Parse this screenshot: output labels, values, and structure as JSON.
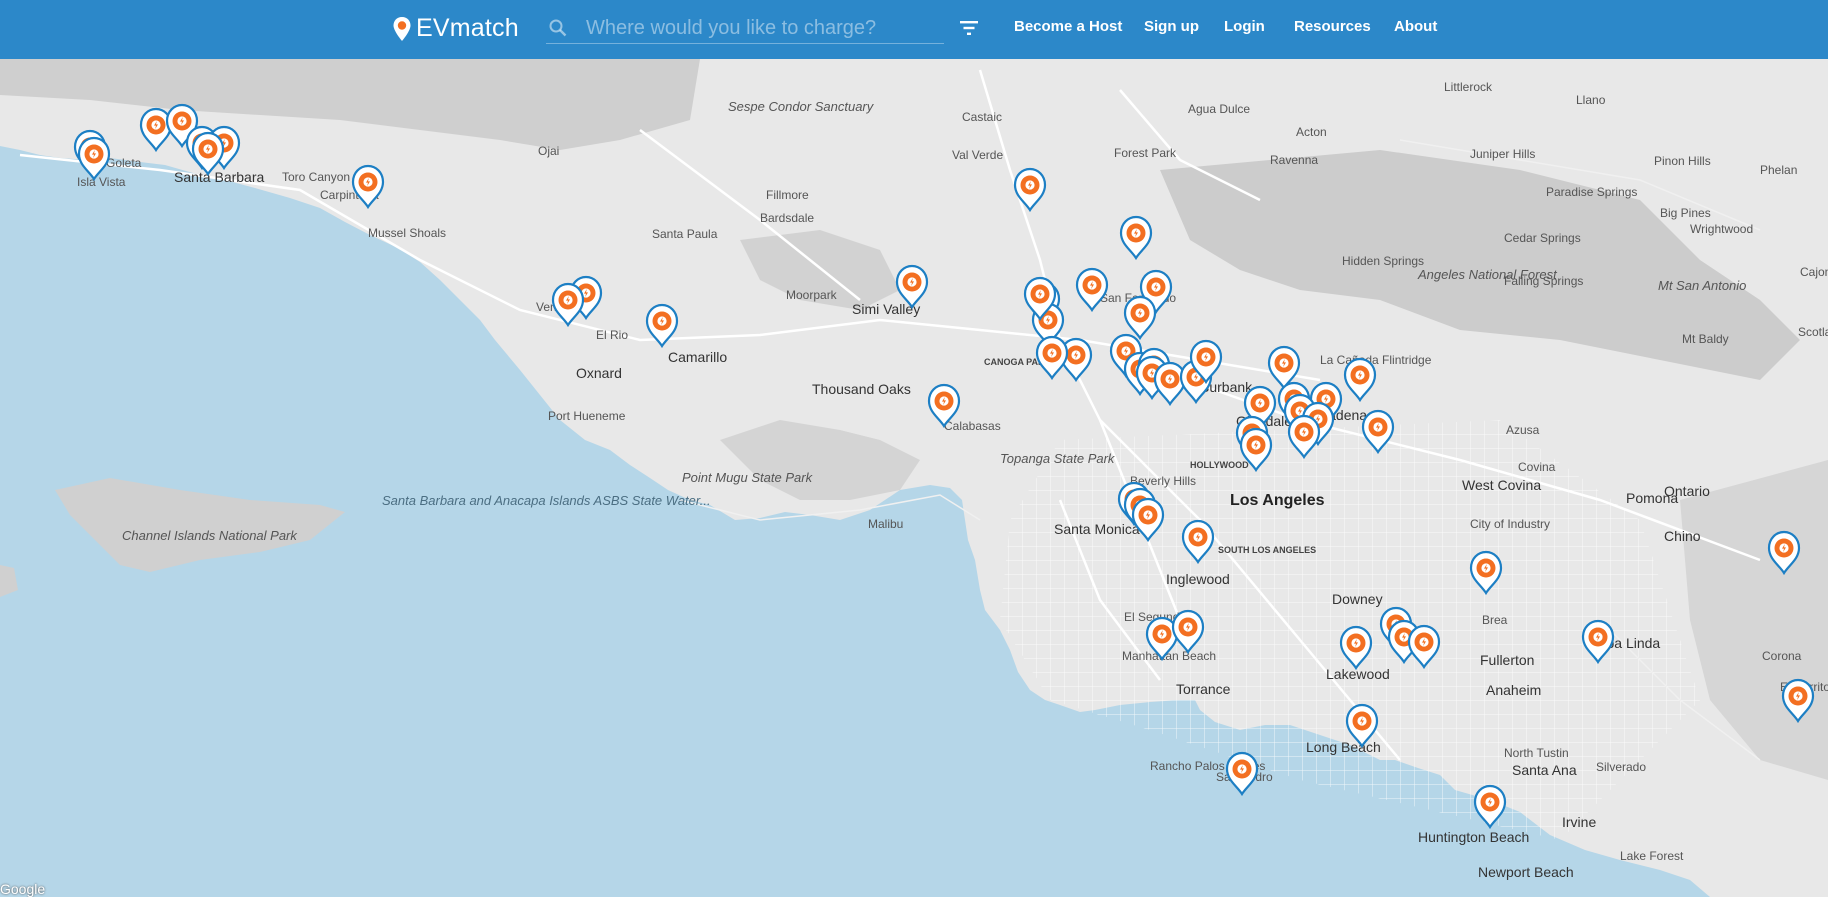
{
  "brand": {
    "name": "EVmatch",
    "accent": "#2c88c9",
    "pin_orange": "#f36f21",
    "pin_blue": "#1d7fc4"
  },
  "search": {
    "placeholder": "Where would you like to charge?",
    "value": ""
  },
  "nav": {
    "filter_icon": "filter-icon",
    "links": [
      "Become a Host",
      "Sign up",
      "Login",
      "Resources",
      "About"
    ]
  },
  "map": {
    "attribution": "Google",
    "big_labels": [
      "Los Angeles"
    ],
    "city_labels": [
      "Santa Barbara",
      "Goleta",
      "Isla Vista",
      "Carpinteria",
      "Ventura",
      "Oxnard",
      "Camarillo",
      "Simi Valley",
      "Thousand Oaks",
      "Calabasas",
      "Santa Monica",
      "Inglewood",
      "Torrance",
      "Long Beach",
      "Downey",
      "Lakewood",
      "Fullerton",
      "Anaheim",
      "Santa Ana",
      "Irvine",
      "Huntington Beach",
      "Newport Beach",
      "Lake Forest",
      "Yorba Linda",
      "Corona",
      "Chino",
      "Ontario",
      "Pomona",
      "West Covina",
      "Azusa",
      "Pasadena",
      "Burbank",
      "La Cañada Flintridge",
      "Glendale",
      "Beverly Hills",
      "San Fernando",
      "Manhattan Beach",
      "El Segundo",
      "Rancho Palos Verdes",
      "San Pedro",
      "Moorpark",
      "Santa Paula",
      "Fillmore",
      "Ojai",
      "Port Hueneme",
      "El Rio",
      "Malibu",
      "Mussel Shoals",
      "Toro Canyon",
      "Bardsdale",
      "Castaic",
      "Val Verde",
      "Agua Dulce",
      "Acton",
      "Ravenna",
      "Littlerock",
      "Llano",
      "Juniper Hills",
      "Pinon Hills",
      "Phelan",
      "Paradise Springs",
      "Big Pines",
      "Wrightwood",
      "Cedar Springs",
      "Falling Springs",
      "Hidden Springs",
      "Mt Baldy",
      "Forest Park",
      "City of Industry",
      "Covina",
      "Brea",
      "North Tustin",
      "Silverado",
      "El Cerrito",
      "Scotland",
      "Cajon"
    ],
    "park_labels": [
      "Sespe Condor Sanctuary",
      "Angeles National Forest",
      "Topanga State Park",
      "Point Mugu State Park",
      "Channel Islands National Park",
      "Mt San Antonio"
    ],
    "sea_labels": [
      "Santa Barbara and Anacapa Islands ASBS State Water..."
    ],
    "district_labels": [
      "CANOGA PARK",
      "HOLLYWOOD",
      "SOUTH LOS ANGELES"
    ],
    "marker_count": 58
  }
}
